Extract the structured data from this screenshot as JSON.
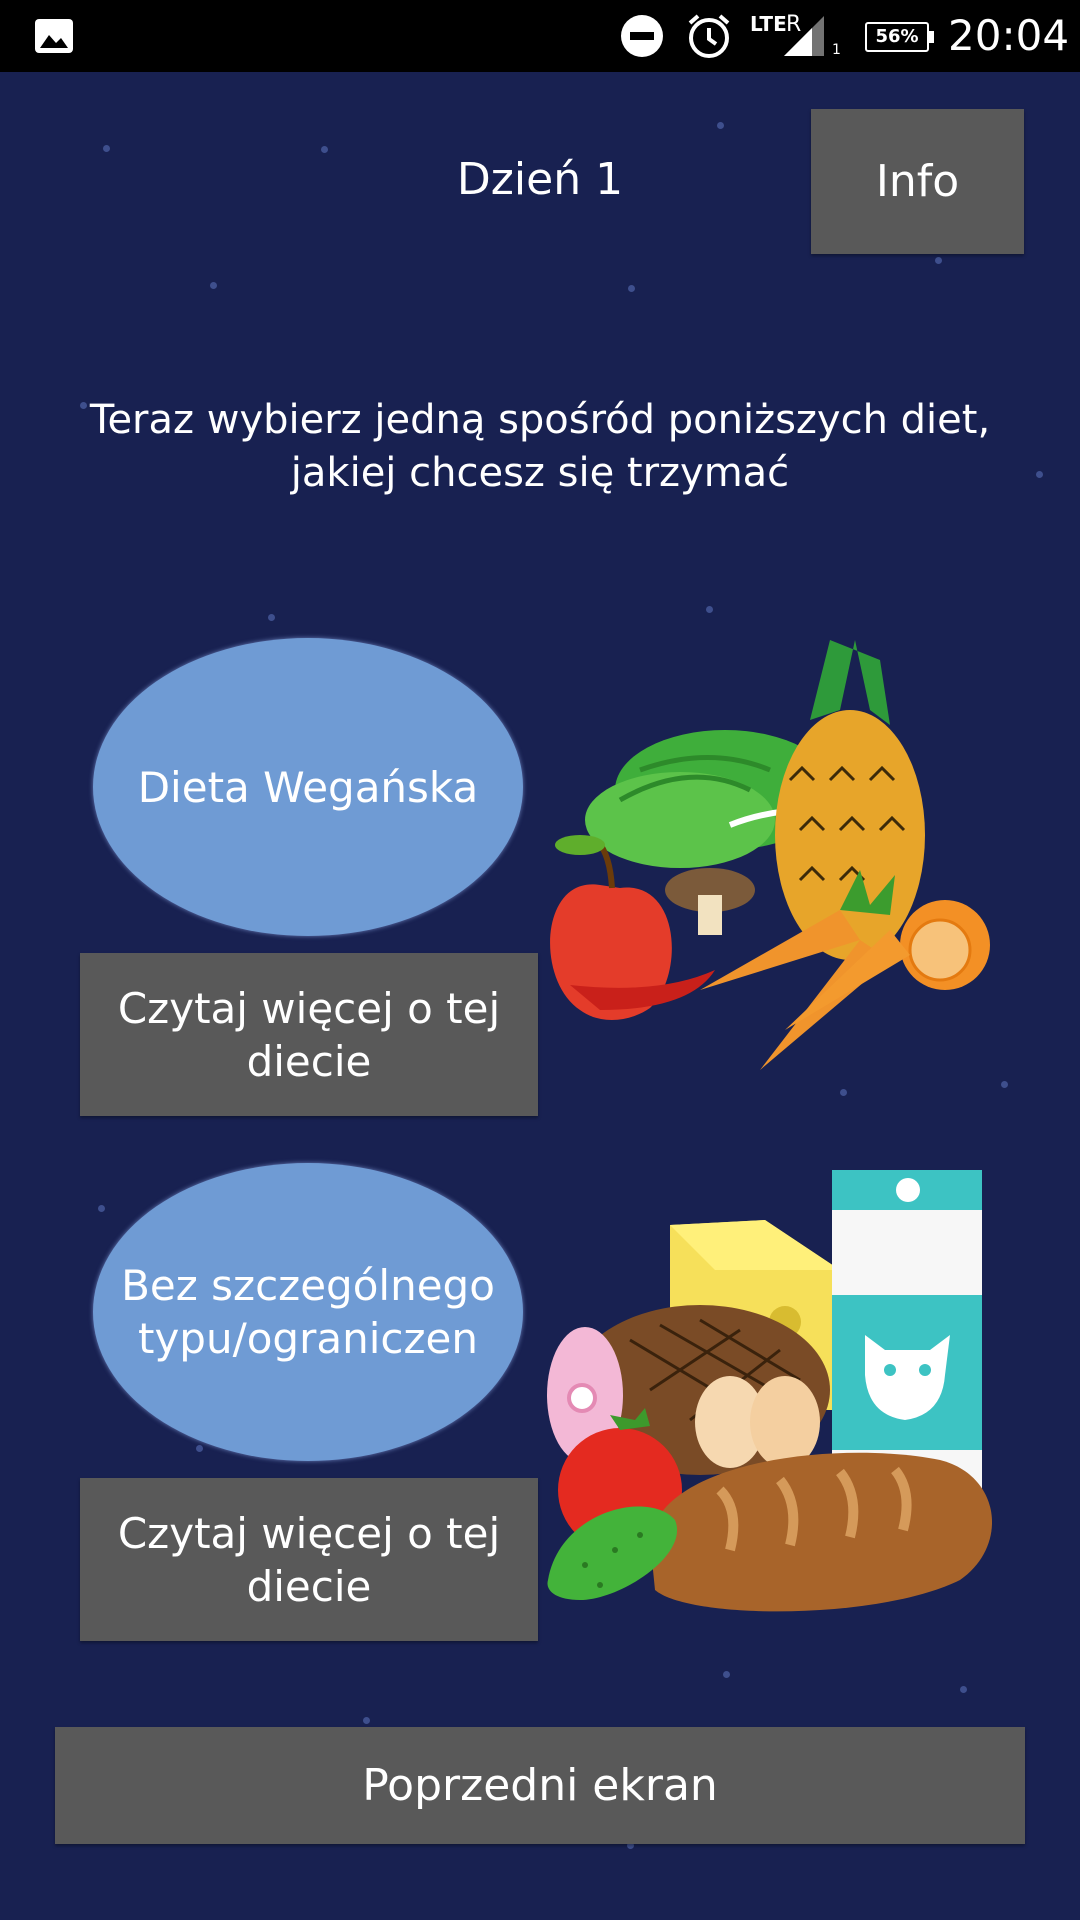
{
  "status_bar": {
    "time": "20:04",
    "battery": "56%",
    "network": "LTE",
    "roaming": "R",
    "sim_slot": "1",
    "icons": [
      "gallery-notification-icon",
      "do-not-disturb-icon",
      "alarm-icon",
      "signal-icon",
      "battery-icon"
    ]
  },
  "header": {
    "title": "Dzień 1",
    "info_button": "Info"
  },
  "prompt": "Teraz wybierz jedną spośród poniższych diet,\njakiej chcesz się trzymać",
  "diets": [
    {
      "label": "Dieta Wegańska",
      "read_more": "Czytaj więcej o tej\ndiecie",
      "image": "vegan-food-illustration"
    },
    {
      "label": "Bez szczególnego\ntypu/ograniczen",
      "read_more": "Czytaj więcej o tej\ndiecie",
      "image": "mixed-food-illustration"
    }
  ],
  "footer": {
    "back_button": "Poprzedni ekran"
  },
  "colors": {
    "background": "#182151",
    "button_grey": "#595959",
    "oval_blue": "#6f9bd4",
    "status_bar": "#000000"
  }
}
